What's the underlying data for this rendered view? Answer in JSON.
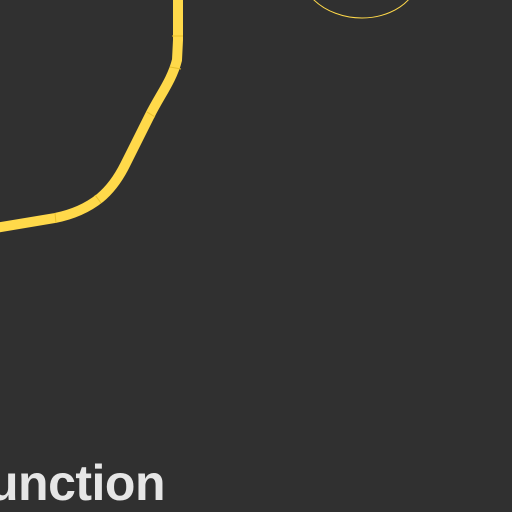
{
  "map": {
    "background_color": "#303030",
    "labels": {
      "place": "unction"
    },
    "colors": {
      "road": "#ffd94a",
      "road_segment_seam": "#e8bf2a",
      "roundabout": "#ffd94a",
      "label_text": "#e6e6e6"
    }
  }
}
